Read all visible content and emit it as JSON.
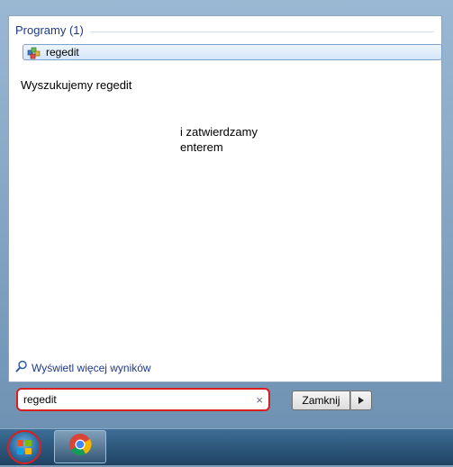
{
  "start_menu": {
    "section_header": "Programy (1)",
    "result_label": "regedit",
    "more_results_label": "Wyświetl więcej wyników",
    "search": {
      "value": "regedit"
    },
    "close_label": "Zamknij"
  },
  "annotations": {
    "line1": "Wyszukujemy regedit",
    "line2": "i zatwierdzamy enterem"
  },
  "icons": {
    "result": "regedit-icon",
    "search": "search-icon",
    "clear": "clear-icon",
    "arrow": "arrow-right-icon",
    "start": "windows-start-icon",
    "taskbar_app": "chrome-icon"
  },
  "colors": {
    "highlight": "#d91f1f",
    "link": "#1e3a8a"
  }
}
